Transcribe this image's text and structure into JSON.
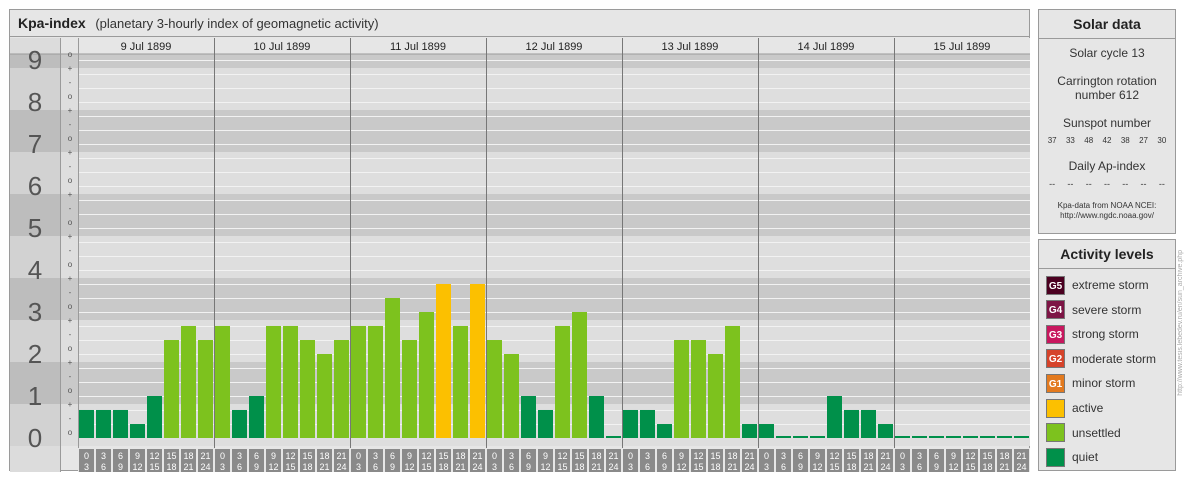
{
  "header": {
    "title": "Kpa-index",
    "subtitle": "(planetary 3-hourly index of geomagnetic activity)"
  },
  "chart_data": {
    "type": "bar",
    "ylim": [
      0,
      9
    ],
    "y_major_labels": [
      "0",
      "1",
      "2",
      "3",
      "4",
      "5",
      "6",
      "7",
      "8",
      "9"
    ],
    "y_minor_labels": [
      "+",
      "o",
      "-"
    ],
    "days": [
      "9 Jul 1899",
      "10 Jul 1899",
      "11 Jul 1899",
      "12 Jul 1899",
      "13 Jul 1899",
      "14 Jul 1899",
      "15 Jul 1899"
    ],
    "interval_top_labels": [
      "0",
      "3",
      "6",
      "9",
      "12",
      "15",
      "18",
      "21"
    ],
    "interval_bottom_labels": [
      "3",
      "6",
      "9",
      "12",
      "15",
      "18",
      "21",
      "24"
    ],
    "values": [
      0.667,
      0.667,
      0.667,
      0.333,
      1.0,
      2.333,
      2.667,
      2.333,
      2.667,
      0.667,
      1.0,
      2.667,
      2.667,
      2.333,
      2.0,
      2.333,
      2.667,
      2.667,
      3.333,
      2.333,
      3.0,
      3.667,
      2.667,
      3.667,
      2.333,
      2.0,
      1.0,
      0.667,
      2.667,
      3.0,
      1.0,
      0.0,
      0.667,
      0.667,
      0.333,
      2.333,
      2.333,
      2.0,
      2.667,
      0.333,
      0.333,
      0.0,
      0.0,
      0.0,
      1.0,
      0.667,
      0.667,
      0.333,
      0.0,
      0.0,
      0.0,
      0.0,
      0.0,
      0.0,
      0.0,
      0.0
    ],
    "colors": {
      "quiet": "#00904a",
      "unsettled": "#7dc21e",
      "active": "#fcc000"
    }
  },
  "solar_data": {
    "title": "Solar data",
    "solar_cycle": "Solar cycle 13",
    "carrington_line1": "Carrington rotation",
    "carrington_line2": "number 612",
    "sunspot_label": "Sunspot number",
    "sunspot_values": [
      "37",
      "33",
      "48",
      "42",
      "38",
      "27",
      "30"
    ],
    "ap_label": "Daily Ap-index",
    "ap_values": [
      "--",
      "--",
      "--",
      "--",
      "--",
      "--",
      "--"
    ],
    "source_line1": "Kpa-data from NOAA NCEI:",
    "source_line2": "http://www.ngdc.noaa.gov/"
  },
  "activity_levels": {
    "title": "Activity levels",
    "items": [
      {
        "badge": "G5",
        "label": "extreme storm",
        "color": "#4b0020"
      },
      {
        "badge": "G4",
        "label": "severe storm",
        "color": "#7d1545"
      },
      {
        "badge": "G3",
        "label": "strong storm",
        "color": "#c8175e"
      },
      {
        "badge": "G2",
        "label": "moderate storm",
        "color": "#d6432a"
      },
      {
        "badge": "G1",
        "label": "minor storm",
        "color": "#e37a1f"
      },
      {
        "badge": "",
        "label": "active",
        "color": "#fcc000"
      },
      {
        "badge": "",
        "label": "unsettled",
        "color": "#7dc21e"
      },
      {
        "badge": "",
        "label": "quiet",
        "color": "#00904a"
      }
    ]
  },
  "credit": "http://www.tesis.lebedev.ru/en/sun_archive.php"
}
